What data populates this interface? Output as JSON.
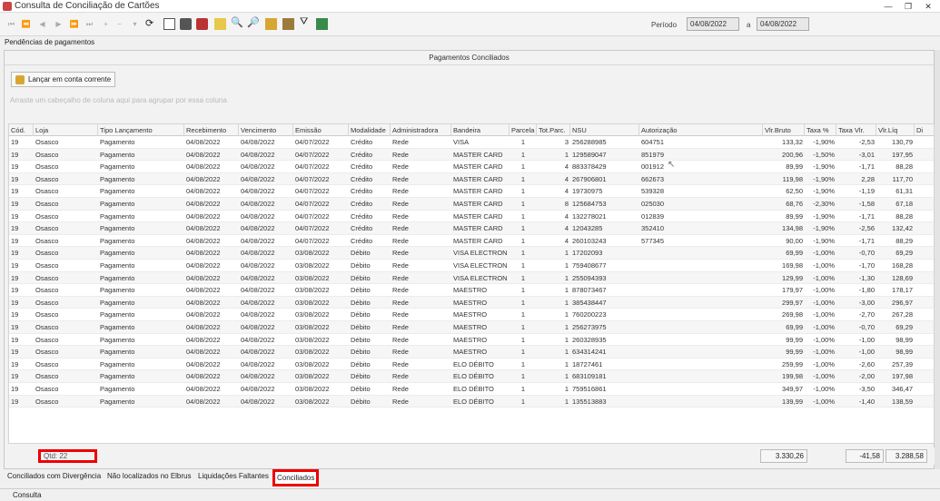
{
  "window": {
    "title": "Consulta de Conciliação de Cartões"
  },
  "toolbar": {
    "period_label": "Período",
    "date_from": "04/08/2022",
    "to_label": "a",
    "date_to": "04/08/2022"
  },
  "section_label": "Pendências de pagamentos",
  "panel": {
    "header": "Pagamentos Conciliados",
    "launch_button": "Lançar em conta corrente",
    "group_hint": "Arraste um cabeçalho de coluna aqui para agrupar por essa coluna"
  },
  "columns": [
    "Cód.",
    "Loja",
    "Tipo Lançamento",
    "Recebimento",
    "Vencimento",
    "Emissão",
    "Modalidade",
    "Administradora",
    "Bandeira",
    "Parcela",
    "Tot.Parc.",
    "NSU",
    "Autorização",
    "Vlr.Bruto",
    "Taxa %",
    "Taxa Vlr.",
    "Vlr.Líq",
    "Di"
  ],
  "rows": [
    [
      "19",
      "Osasco",
      "Pagamento",
      "04/08/2022",
      "04/08/2022",
      "04/07/2022",
      "Crédito",
      "Rede",
      "VISA",
      "1",
      "3",
      "256288985",
      "604751",
      "133,32",
      "-1,90%",
      "-2,53",
      "130,79"
    ],
    [
      "19",
      "Osasco",
      "Pagamento",
      "04/08/2022",
      "04/08/2022",
      "04/07/2022",
      "Crédito",
      "Rede",
      "MASTER CARD",
      "1",
      "1",
      "129589047",
      "851979",
      "200,96",
      "-1,50%",
      "-3,01",
      "197,95"
    ],
    [
      "19",
      "Osasco",
      "Pagamento",
      "04/08/2022",
      "04/08/2022",
      "04/07/2022",
      "Crédito",
      "Rede",
      "MASTER CARD",
      "1",
      "4",
      "883378429",
      "001912",
      "89,99",
      "-1,90%",
      "-1,71",
      "88,28"
    ],
    [
      "19",
      "Osasco",
      "Pagamento",
      "04/08/2022",
      "04/08/2022",
      "04/07/2022",
      "Crédito",
      "Rede",
      "MASTER CARD",
      "1",
      "4",
      "267906801",
      "662673",
      "119,98",
      "-1,90%",
      "2,28",
      "117,70"
    ],
    [
      "19",
      "Osasco",
      "Pagamento",
      "04/08/2022",
      "04/08/2022",
      "04/07/2022",
      "Crédito",
      "Rede",
      "MASTER CARD",
      "1",
      "4",
      "19730975",
      "539328",
      "62,50",
      "-1,90%",
      "-1,19",
      "61,31"
    ],
    [
      "19",
      "Osasco",
      "Pagamento",
      "04/08/2022",
      "04/08/2022",
      "04/07/2022",
      "Crédito",
      "Rede",
      "MASTER CARD",
      "1",
      "8",
      "125684753",
      "025030",
      "68,76",
      "-2,30%",
      "-1,58",
      "67,18"
    ],
    [
      "19",
      "Osasco",
      "Pagamento",
      "04/08/2022",
      "04/08/2022",
      "04/07/2022",
      "Crédito",
      "Rede",
      "MASTER CARD",
      "1",
      "4",
      "132278021",
      "012839",
      "89,99",
      "-1,90%",
      "-1,71",
      "88,28"
    ],
    [
      "19",
      "Osasco",
      "Pagamento",
      "04/08/2022",
      "04/08/2022",
      "04/07/2022",
      "Crédito",
      "Rede",
      "MASTER CARD",
      "1",
      "4",
      "12043285",
      "352410",
      "134,98",
      "-1,90%",
      "-2,56",
      "132,42"
    ],
    [
      "19",
      "Osasco",
      "Pagamento",
      "04/08/2022",
      "04/08/2022",
      "04/07/2022",
      "Crédito",
      "Rede",
      "MASTER CARD",
      "1",
      "4",
      "260103243",
      "577345",
      "90,00",
      "-1,90%",
      "-1,71",
      "88,29"
    ],
    [
      "19",
      "Osasco",
      "Pagamento",
      "04/08/2022",
      "04/08/2022",
      "03/08/2022",
      "Débito",
      "Rede",
      "VISA ELECTRON",
      "1",
      "1",
      "17202093",
      "",
      "69,99",
      "-1,00%",
      "-0,70",
      "69,29"
    ],
    [
      "19",
      "Osasco",
      "Pagamento",
      "04/08/2022",
      "04/08/2022",
      "03/08/2022",
      "Débito",
      "Rede",
      "VISA ELECTRON",
      "1",
      "1",
      "759408677",
      "",
      "169,98",
      "-1,00%",
      "-1,70",
      "168,28"
    ],
    [
      "19",
      "Osasco",
      "Pagamento",
      "04/08/2022",
      "04/08/2022",
      "03/08/2022",
      "Débito",
      "Rede",
      "VISA ELECTRON",
      "1",
      "1",
      "255094393",
      "",
      "129,99",
      "-1,00%",
      "-1,30",
      "128,69"
    ],
    [
      "19",
      "Osasco",
      "Pagamento",
      "04/08/2022",
      "04/08/2022",
      "03/08/2022",
      "Débito",
      "Rede",
      "MAESTRO",
      "1",
      "1",
      "878073467",
      "",
      "179,97",
      "-1,00%",
      "-1,80",
      "178,17"
    ],
    [
      "19",
      "Osasco",
      "Pagamento",
      "04/08/2022",
      "04/08/2022",
      "03/08/2022",
      "Débito",
      "Rede",
      "MAESTRO",
      "1",
      "1",
      "385438447",
      "",
      "299,97",
      "-1,00%",
      "-3,00",
      "296,97"
    ],
    [
      "19",
      "Osasco",
      "Pagamento",
      "04/08/2022",
      "04/08/2022",
      "03/08/2022",
      "Débito",
      "Rede",
      "MAESTRO",
      "1",
      "1",
      "760200223",
      "",
      "269,98",
      "-1,00%",
      "-2,70",
      "267,28"
    ],
    [
      "19",
      "Osasco",
      "Pagamento",
      "04/08/2022",
      "04/08/2022",
      "03/08/2022",
      "Débito",
      "Rede",
      "MAESTRO",
      "1",
      "1",
      "256273975",
      "",
      "69,99",
      "-1,00%",
      "-0,70",
      "69,29"
    ],
    [
      "19",
      "Osasco",
      "Pagamento",
      "04/08/2022",
      "04/08/2022",
      "03/08/2022",
      "Débito",
      "Rede",
      "MAESTRO",
      "1",
      "1",
      "260328935",
      "",
      "99,99",
      "-1,00%",
      "-1,00",
      "98,99"
    ],
    [
      "19",
      "Osasco",
      "Pagamento",
      "04/08/2022",
      "04/08/2022",
      "03/08/2022",
      "Débito",
      "Rede",
      "MAESTRO",
      "1",
      "1",
      "634314241",
      "",
      "99,99",
      "-1,00%",
      "-1,00",
      "98,99"
    ],
    [
      "19",
      "Osasco",
      "Pagamento",
      "04/08/2022",
      "04/08/2022",
      "03/08/2022",
      "Débito",
      "Rede",
      "ELO DÉBITO",
      "1",
      "1",
      "18727461",
      "",
      "259,99",
      "-1,00%",
      "-2,60",
      "257,39"
    ],
    [
      "19",
      "Osasco",
      "Pagamento",
      "04/08/2022",
      "04/08/2022",
      "03/08/2022",
      "Débito",
      "Rede",
      "ELO DÉBITO",
      "1",
      "1",
      "683109181",
      "",
      "199,98",
      "-1,00%",
      "-2,00",
      "197,98"
    ],
    [
      "19",
      "Osasco",
      "Pagamento",
      "04/08/2022",
      "04/08/2022",
      "03/08/2022",
      "Débito",
      "Rede",
      "ELO DÉBITO",
      "1",
      "1",
      "759516861",
      "",
      "349,97",
      "-1,00%",
      "-3,50",
      "346,47"
    ],
    [
      "19",
      "Osasco",
      "Pagamento",
      "04/08/2022",
      "04/08/2022",
      "03/08/2022",
      "Débito",
      "Rede",
      "ELO DÉBITO",
      "1",
      "1",
      "135513883",
      "",
      "139,99",
      "-1,00%",
      "-1,40",
      "138,59"
    ]
  ],
  "footer": {
    "qtd": "Qtd: 22",
    "total_bruto": "3.330,26",
    "total_taxa": "-41,58",
    "total_liq": "3.288,58"
  },
  "tabs": [
    "Conciliados com Divergência",
    "Não localizados no Elbrus",
    "Liquidações Faltantes",
    "Conciliados"
  ],
  "status": "Consulta",
  "accent_red": "#e00000"
}
